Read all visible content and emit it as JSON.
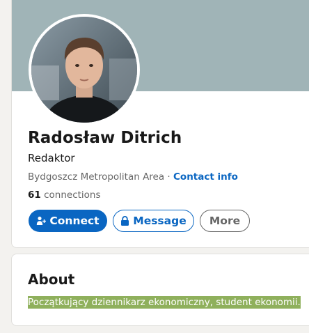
{
  "profile": {
    "name": "Radosław Ditrich",
    "headline": "Redaktor",
    "location": "Bydgoszcz Metropolitan Area",
    "separator": " · ",
    "contact_info": "Contact info",
    "connections_count": "61",
    "connections_label": " connections"
  },
  "actions": {
    "connect": "Connect",
    "message": "Message",
    "more": "More"
  },
  "about": {
    "title": "About",
    "text": "Początkujący dziennikarz ekonomiczny, student ekonomii."
  },
  "colors": {
    "accent": "#0a66c2",
    "banner": "#a0b4b7",
    "highlight": "#8fb05c"
  },
  "icons": {
    "connect": "add-person-icon",
    "message": "lock-icon"
  }
}
